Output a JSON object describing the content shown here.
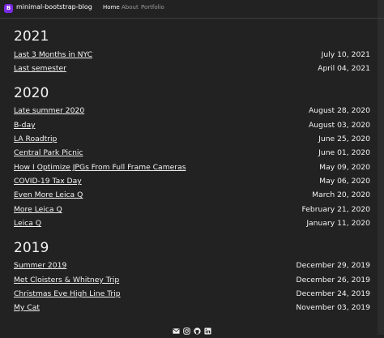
{
  "nav": {
    "brand_initial": "B",
    "brand_name": "minimal-bootstrap-blog",
    "links": [
      {
        "label": "Home",
        "active": true
      },
      {
        "label": "About",
        "active": false
      },
      {
        "label": "Portfolio",
        "active": false
      }
    ]
  },
  "groups": [
    {
      "year": "2021",
      "posts": [
        {
          "title": "Last 3 Months in NYC",
          "date": "July 10, 2021"
        },
        {
          "title": "Last semester",
          "date": "April 04, 2021"
        }
      ]
    },
    {
      "year": "2020",
      "posts": [
        {
          "title": "Late summer 2020",
          "date": "August 28, 2020"
        },
        {
          "title": "B-day",
          "date": "August 03, 2020"
        },
        {
          "title": "LA Roadtrip",
          "date": "June 25, 2020"
        },
        {
          "title": "Central Park Picnic",
          "date": "June 01, 2020"
        },
        {
          "title": "How I Optimize JPGs From Full Frame Cameras",
          "date": "May 09, 2020"
        },
        {
          "title": "COVID-19 Tax Day",
          "date": "May 06, 2020"
        },
        {
          "title": "Even More Leica Q",
          "date": "March 20, 2020"
        },
        {
          "title": "More Leica Q",
          "date": "February 21, 2020"
        },
        {
          "title": "Leica Q",
          "date": "January 11, 2020"
        }
      ]
    },
    {
      "year": "2019",
      "posts": [
        {
          "title": "Summer 2019",
          "date": "December 29, 2019"
        },
        {
          "title": "Met Cloisters & Whitney Trip",
          "date": "December 26, 2019"
        },
        {
          "title": "Christmas Eve High Line Trip",
          "date": "December 24, 2019"
        },
        {
          "title": "My Cat",
          "date": "November 03, 2019"
        }
      ]
    }
  ],
  "footer": {
    "icons": [
      "email-icon",
      "instagram-icon",
      "github-icon",
      "linkedin-icon"
    ]
  },
  "colors": {
    "background": "#222222",
    "text": "#f2f2f2",
    "brand": "#7a2be2",
    "nav_inactive": "#9b9b9b"
  }
}
